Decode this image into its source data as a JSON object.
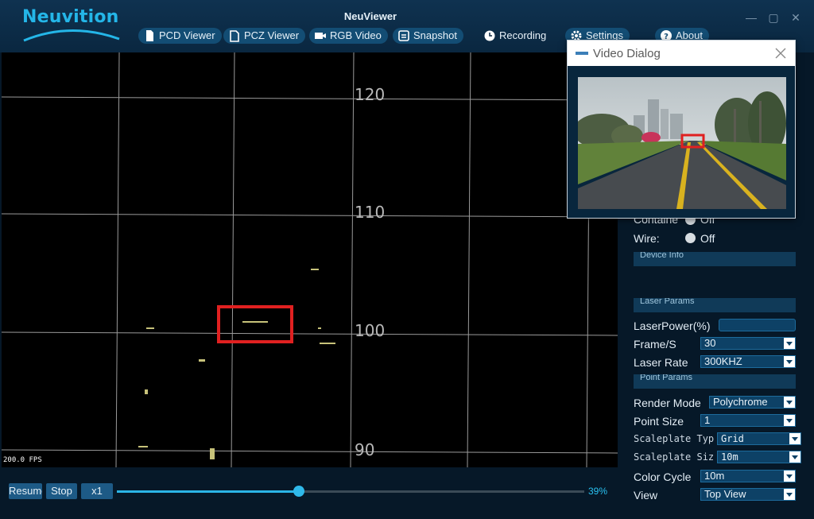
{
  "app": {
    "brand": "Neuvition",
    "title": "NeuViewer",
    "window_controls": [
      "minimize-icon",
      "maximize-icon",
      "close-icon"
    ]
  },
  "nav": {
    "tabs": [
      {
        "label": "PCD Viewer",
        "icon": "file-icon"
      },
      {
        "label": "PCZ Viewer",
        "icon": "file-icon"
      },
      {
        "label": "RGB Video",
        "icon": "video-camera-icon"
      },
      {
        "label": "Snapshot",
        "icon": "snapshot-icon"
      },
      {
        "label": "Recording",
        "icon": "clock-icon"
      },
      {
        "label": "Settings",
        "icon": "gear-icon"
      },
      {
        "label": "About",
        "icon": "help-icon"
      }
    ]
  },
  "viewport": {
    "grid_labels": [
      "120",
      "110",
      "100",
      "90"
    ],
    "fps": "200.0 FPS"
  },
  "playback": {
    "resume_label": "Resume",
    "stop_label": "Stop",
    "speed_label": "x1",
    "progress": 0.39,
    "progress_text": "39%"
  },
  "panel": {
    "container_label": "Containe",
    "container_value": "Off",
    "wire_label": "Wire:",
    "wire_value": "Off",
    "sections": {
      "device_info": "Device Info",
      "laser_params": "Laser Params",
      "point_params": "Point Params"
    },
    "laser_power_label": "LaserPower(%)",
    "laser_power_value": "",
    "frame_rate_label": "Frame/S",
    "frame_rate_value": "30",
    "laser_rate_label": "Laser Rate",
    "laser_rate_value": "300KHZ",
    "render_mode_label": "Render Mode",
    "render_mode_value": "Polychrome",
    "point_size_label": "Point Size",
    "point_size_value": "1",
    "scaleplate_type_label": "Scaleplate Typ",
    "scaleplate_type_value": "Grid",
    "scaleplate_size_label": "Scaleplate Siz",
    "scaleplate_size_value": "10m",
    "color_cycle_label": "Color Cycle",
    "color_cycle_value": "10m",
    "view_label": "View",
    "view_value": "Top View"
  },
  "dialog": {
    "title": "Video Dialog"
  },
  "colors": {
    "accent": "#2bb5e6",
    "highlight_box": "#e02020",
    "panel_bg": "#061828",
    "button_bg": "#1d5a86"
  }
}
